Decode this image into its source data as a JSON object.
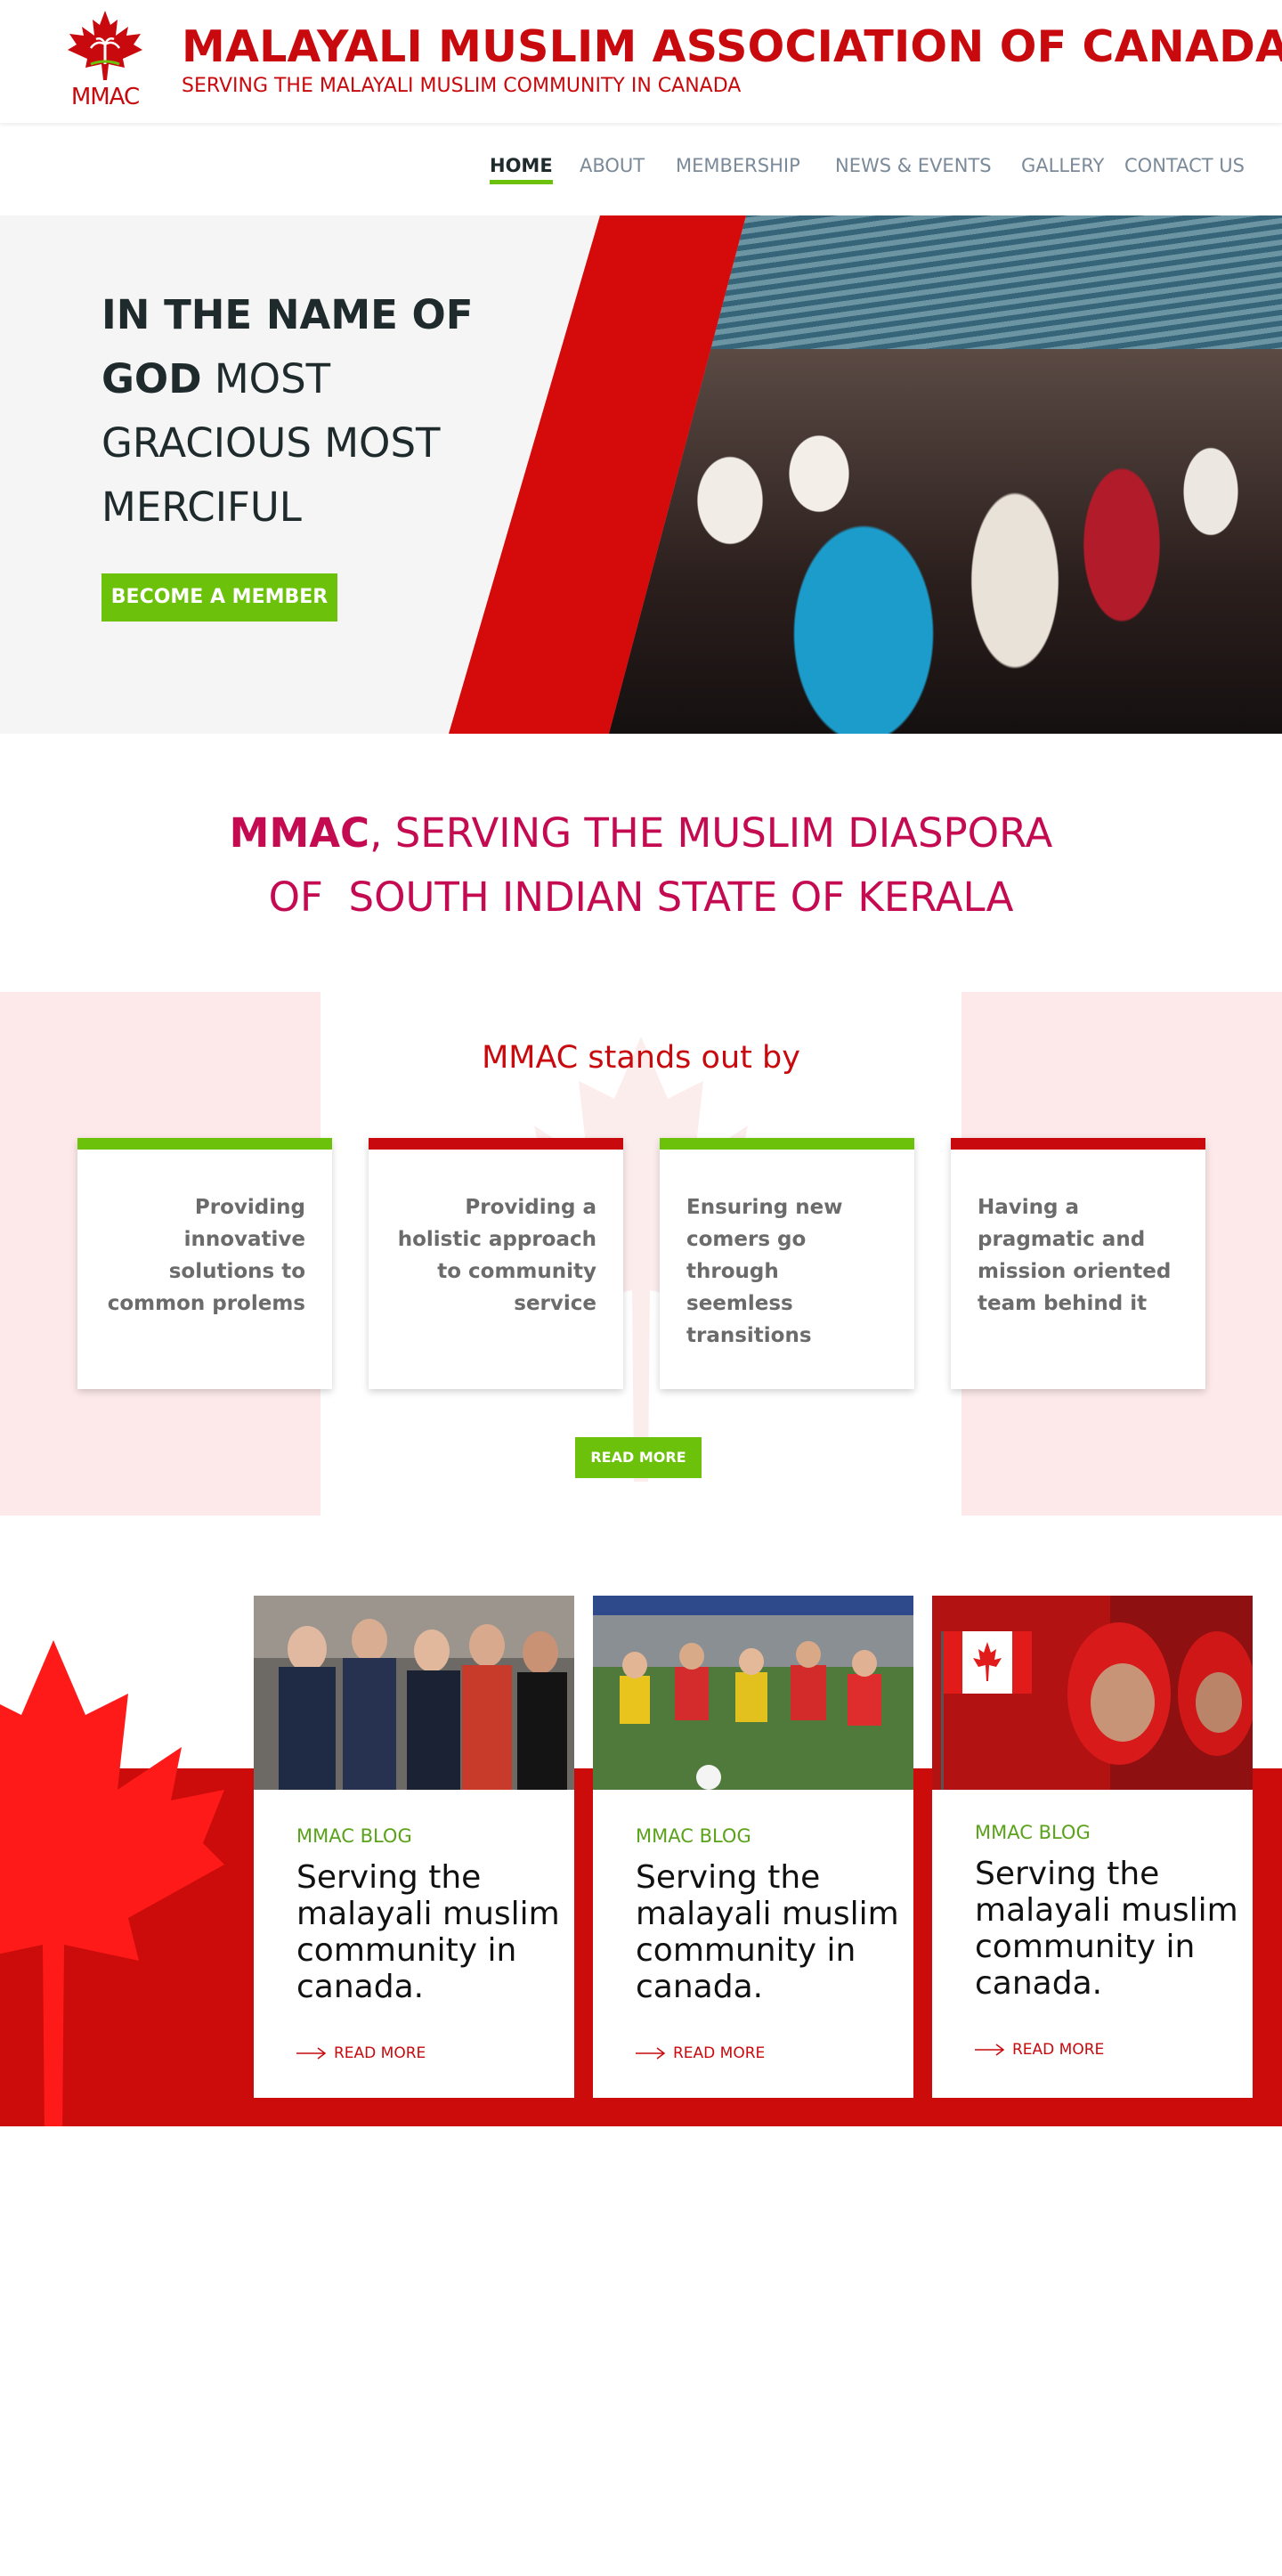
{
  "header": {
    "logo_text": "MMAC",
    "title": "MALAYALI MUSLIM ASSOCIATION OF CANADA",
    "tagline": "SERVING THE MALAYALI MUSLIM COMMUNITY IN CANADA",
    "brand_color": "#c8090d"
  },
  "nav": {
    "items": [
      {
        "label": "HOME",
        "active": true
      },
      {
        "label": "ABOUT"
      },
      {
        "label": "MEMBERSHIP"
      },
      {
        "label": "NEWS & EVENTS"
      },
      {
        "label": "GALLERY"
      },
      {
        "label": "CONTACT US"
      }
    ],
    "active_color": "#6cc10b"
  },
  "hero": {
    "line_bold": "IN THE NAME OF GOD",
    "line_rest": "MOST GRACIOUS MOST MERCIFUL",
    "bold_1": "IN THE NAME OF",
    "bold_2": "GOD",
    "rest_1": " MOST",
    "rest_2": "GRACIOUS MOST",
    "rest_3": "MERCIFUL",
    "button": "BECOME A MEMBER",
    "accent_red": "#d50a0a"
  },
  "mission": {
    "brand": "MMAC",
    "line1_rest": ", SERVING THE MUSLIM DIASPORA",
    "line2": "OF  SOUTH INDIAN STATE OF KERALA",
    "color": "#c40b52"
  },
  "stands_out": {
    "title": "MMAC stands out by",
    "cards": [
      {
        "text": "Providing innovative solutions to common prolems",
        "bar_color": "#6cc10b"
      },
      {
        "text": "Providing a holistic approach to community service",
        "bar_color": "#c8090d"
      },
      {
        "text": "Ensuring new comers go through seemless transitions",
        "bar_color": "#6cc10b"
      },
      {
        "text": "Having a pragmatic and mission oriented team behind it",
        "bar_color": "#c8090d"
      }
    ],
    "button": "READ MORE"
  },
  "blog": {
    "posts": [
      {
        "category": "MMAC BLOG",
        "title": "Serving the malayali muslim community in canada.",
        "more": "READ MORE"
      },
      {
        "category": "MMAC BLOG",
        "title": "Serving the malayali muslim community in canada.",
        "more": "READ MORE"
      },
      {
        "category": "MMAC BLOG",
        "title": "Serving the malayali muslim community in canada.",
        "more": "READ MORE"
      }
    ]
  }
}
